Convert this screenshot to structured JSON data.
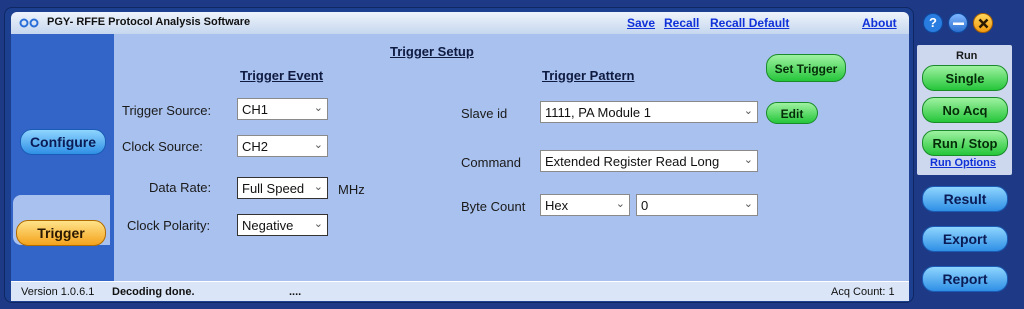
{
  "titlebar": {
    "app_title": "PGY- RFFE Protocol Analysis Software",
    "links": {
      "save": "Save",
      "recall": "Recall",
      "recall_default": "Recall Default",
      "about": "About"
    }
  },
  "nav": {
    "configure": "Configure",
    "trigger": "Trigger"
  },
  "trigger_setup": {
    "title": "Trigger Setup",
    "event": {
      "heading": "Trigger Event",
      "trigger_source": {
        "label": "Trigger Source:",
        "value": "CH1"
      },
      "clock_source": {
        "label": "Clock Source:",
        "value": "CH2"
      },
      "data_rate": {
        "label": "Data Rate:",
        "value": "Full Speed",
        "unit": "MHz"
      },
      "clock_polarity": {
        "label": "Clock Polarity:",
        "value": "Negative"
      }
    },
    "pattern": {
      "heading": "Trigger Pattern",
      "set_trigger": "Set Trigger",
      "slave_id": {
        "label": "Slave id",
        "value": "1111, PA Module 1"
      },
      "edit": "Edit",
      "command": {
        "label": "Command",
        "value": "Extended Register Read Long"
      },
      "byte_count": {
        "label": "Byte Count",
        "format": "Hex",
        "value": "0"
      }
    }
  },
  "status": {
    "version": "Version 1.0.6.1",
    "message": "Decoding done.",
    "ellipsis": "....",
    "acq_count": "Acq Count: 1"
  },
  "controls": {
    "help": "?",
    "run_label": "Run",
    "single": "Single",
    "no_acq": "No Acq",
    "run_stop": "Run / Stop",
    "run_options": "Run Options",
    "result": "Result",
    "export": "Export",
    "report": "Report"
  },
  "colors": {
    "accent_green": "#25c63a",
    "accent_blue": "#2f8fe5",
    "accent_orange": "#f4a21c",
    "panel": "#a9c1ee"
  },
  "icons": [
    "app-logo-icon",
    "help-icon",
    "minimize-icon",
    "close-icon",
    "chevron-down-icon"
  ]
}
